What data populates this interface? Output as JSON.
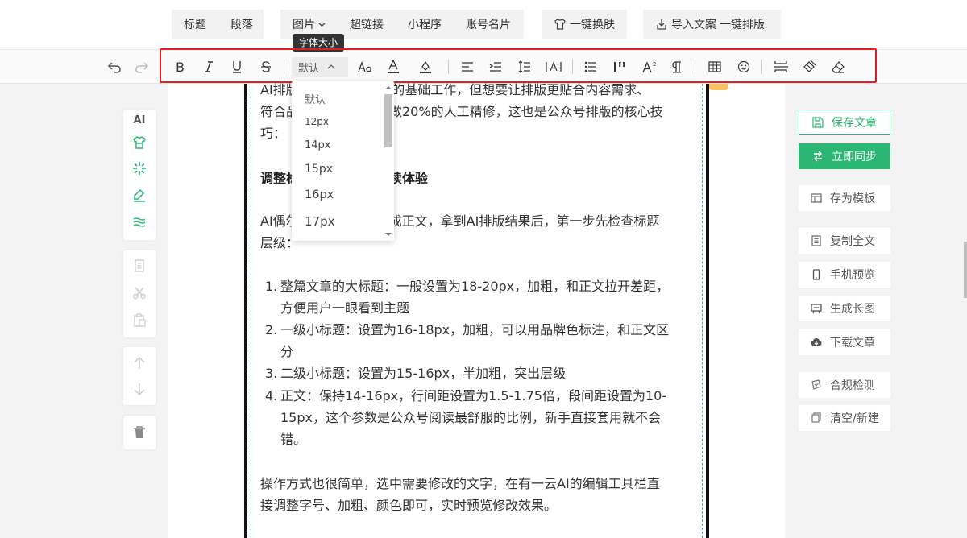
{
  "topmenu": {
    "title": "标题",
    "paragraph": "段落",
    "image": "图片",
    "hyperlink": "超链接",
    "miniprogram": "小程序",
    "account_card": "账号名片",
    "one_click_skin": "一键换肤",
    "import_article": "导入文案",
    "one_click_layout": "一键排版"
  },
  "toolbar": {
    "font_size_value": "默认",
    "tooltip": "字体大小"
  },
  "font_size_options": [
    "默认",
    "12px",
    "14px",
    "15px",
    "16px",
    "17px"
  ],
  "left_panel": {
    "ai_label": "AI"
  },
  "article": {
    "para1": "AI排版能帮你完成80%的基础工作，但想要让排版更贴合内容需求、符合品牌调性，还需要做20%的人工精修，这也是公众号排版的核心技巧：",
    "para1_visible_line1": "AI排版能帮你完成80%的基础工作，但想要让排版更贴合内容需求、",
    "para1_visible_line2": "符合品牌调性，还需要做20%的人工精修，这也是公众号排版的核心技",
    "para1_visible_line3": "巧：",
    "heading": "调整标题层级，优化阅读体验",
    "para2_line1": "AI偶尔会将小标题识别成正文，拿到AI排版结果后，第一步先检查标题",
    "para2_line2": "层级：",
    "list": [
      {
        "num": "1.",
        "line1": "整篇文章的大标题：一般设置为18-20px，加粗，和正文拉开差距，",
        "line2": "方便用户一眼看到主题"
      },
      {
        "num": "2.",
        "line1": "一级小标题：设置为16-18px，加粗，可以用品牌色标注，和正文区",
        "line2": "分"
      },
      {
        "num": "3.",
        "line1": "二级小标题：设置为15-16px，半加粗，突出层级",
        "line2": ""
      },
      {
        "num": "4.",
        "line1": "正文：保持14-16px，行间距设置为1.5-1.75倍，段间距设置为10-",
        "line2": "15px，这个参数是公众号阅读最舒服的比例，新手直接套用就不会",
        "line3": "错。"
      }
    ],
    "para3_line1": "操作方式也很简单，选中需要修改的文字，在有一云AI的编辑工具栏直",
    "para3_line2": "接调整字号、加粗、颜色即可，实时预览修改效果。"
  },
  "right_panel": {
    "save": "保存文章",
    "sync": "立即同步",
    "save_template": "存为模板",
    "copy_all": "复制全文",
    "mobile_preview": "手机预览",
    "long_image": "生成长图",
    "download": "下载文章",
    "compliance": "合规检测",
    "clear_new": "清空/新建"
  },
  "colors": {
    "accent_green": "#2bb673",
    "highlight_red": "#e02020",
    "guide_dashed": "#45b58e"
  }
}
